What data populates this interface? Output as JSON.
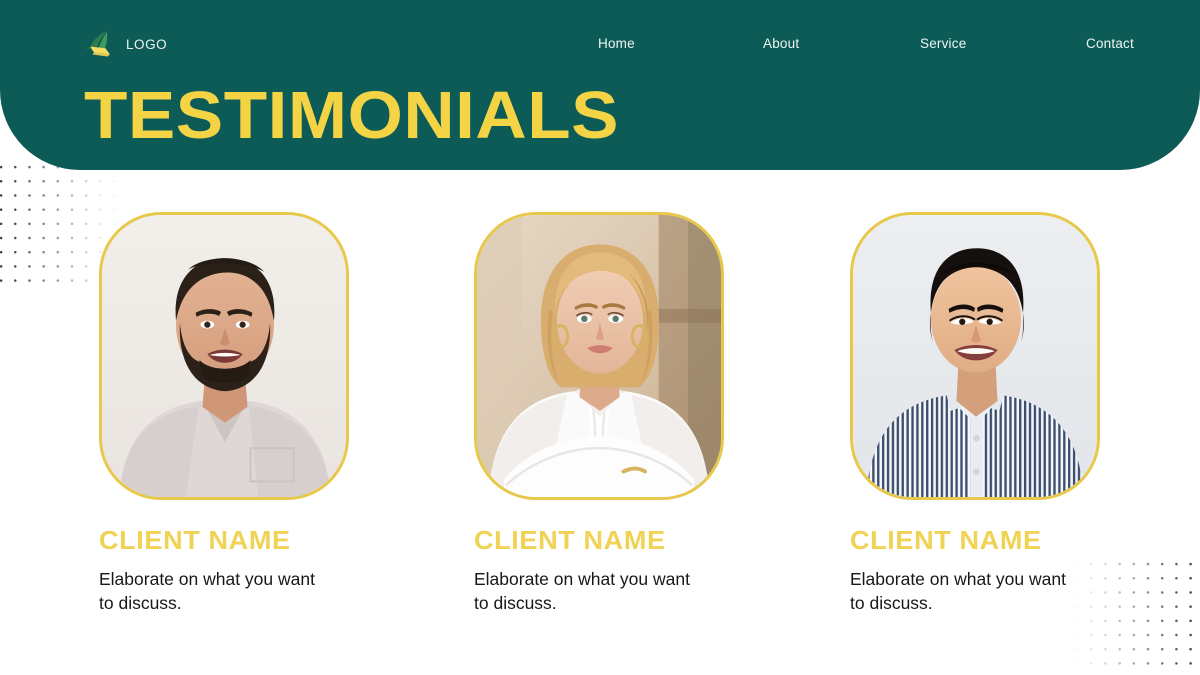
{
  "brand": {
    "logo_icon": "leaf-logo-icon",
    "name": "LOGO"
  },
  "nav": {
    "items": [
      {
        "label": "Home"
      },
      {
        "label": "About"
      },
      {
        "label": "Service"
      },
      {
        "label": "Contact"
      }
    ]
  },
  "header": {
    "title": "TESTIMONIALS",
    "background_color": "#0d5b56",
    "title_color": "#f4d444"
  },
  "testimonials": [
    {
      "name": "CLIENT NAME",
      "quote": "Elaborate on what you want to discuss.",
      "photo_alt": "bearded-man-in-light-tshirt"
    },
    {
      "name": "CLIENT NAME",
      "quote": "Elaborate on what you want to discuss.",
      "photo_alt": "blonde-woman-in-white-blouse"
    },
    {
      "name": "CLIENT NAME",
      "quote": "Elaborate on what you want to discuss.",
      "photo_alt": "man-in-striped-shirt"
    }
  ],
  "decor": {
    "dot_pattern_top_left": "dot-grid",
    "dot_pattern_bottom_right": "dot-grid",
    "accent_color": "#e8c84a",
    "page_background": "#ffffff"
  }
}
